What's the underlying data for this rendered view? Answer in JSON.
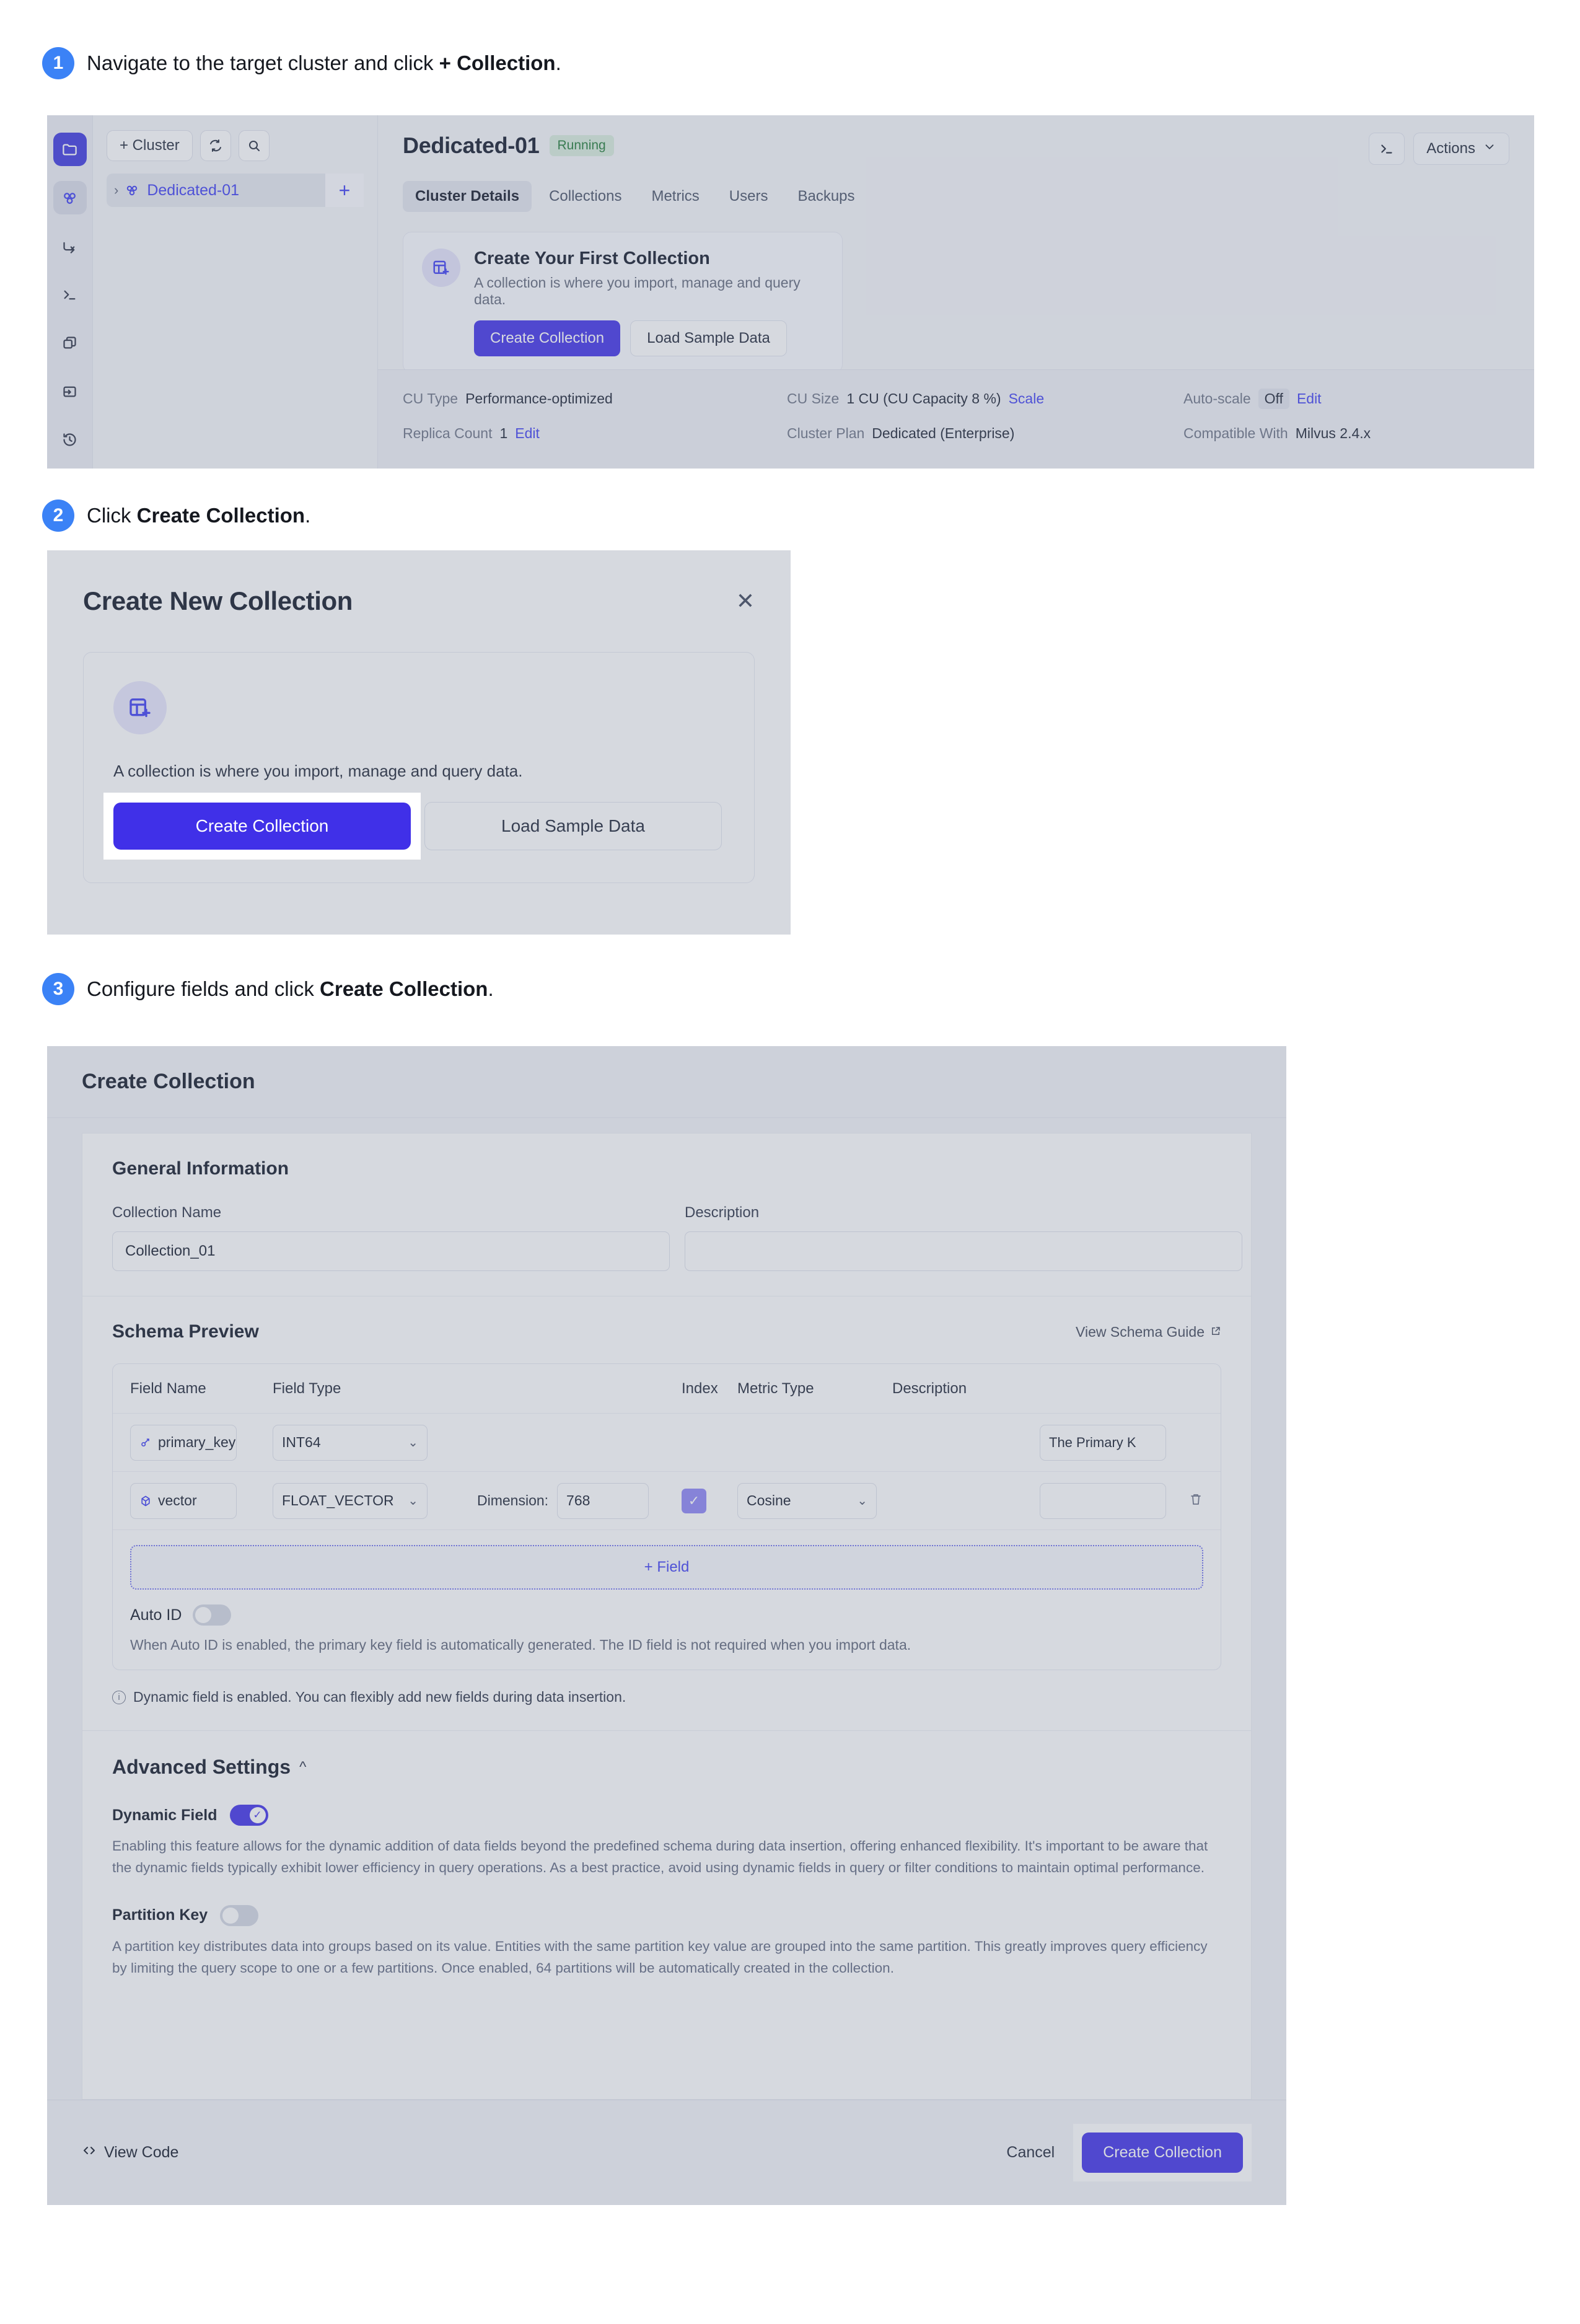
{
  "steps": [
    {
      "num": "1",
      "prefix": "Navigate to the target cluster and click ",
      "bold": "+ Collection",
      "suffix": "."
    },
    {
      "num": "2",
      "prefix": "Click ",
      "bold": "Create Collection",
      "suffix": "."
    },
    {
      "num": "3",
      "prefix": "Configure fields and click ",
      "bold": "Create Collection",
      "suffix": "."
    }
  ],
  "panel1": {
    "cluster_pane": {
      "add_cluster_label": "+ Cluster",
      "refresh_icon": "refresh-icon",
      "search_icon": "search-icon",
      "cluster_name": "Dedicated-01",
      "add_collection_label": "+"
    },
    "rail_icons": [
      "folder-icon",
      "cluster-icon",
      "import-icon",
      "console-icon",
      "copy-icon",
      "export-icon",
      "history-icon"
    ],
    "header": {
      "title": "Dedicated-01",
      "status": "Running",
      "terminal_icon": "terminal-icon",
      "actions_label": "Actions"
    },
    "tabs": [
      {
        "label": "Cluster Details",
        "selected": true
      },
      {
        "label": "Collections",
        "selected": false
      },
      {
        "label": "Metrics",
        "selected": false
      },
      {
        "label": "Users",
        "selected": false
      },
      {
        "label": "Backups",
        "selected": false
      }
    ],
    "first_collection_card": {
      "icon": "table-plus-icon",
      "title": "Create Your First Collection",
      "subtitle": "A collection is where you import, manage and query data.",
      "primary_button": "Create Collection",
      "secondary_button": "Load Sample Data"
    },
    "stats": [
      {
        "label": "CU Type",
        "value": "Performance-optimized",
        "link": "",
        "pill": ""
      },
      {
        "label": "CU Size",
        "value": "1 CU (CU Capacity 8 %)",
        "link": "Scale",
        "pill": ""
      },
      {
        "label": "Auto-scale",
        "value": "",
        "link": "Edit",
        "pill": "Off"
      },
      {
        "label": "Replica Count",
        "value": "1",
        "link": "Edit",
        "pill": ""
      },
      {
        "label": "Cluster Plan",
        "value": "Dedicated (Enterprise)",
        "link": "",
        "pill": ""
      },
      {
        "label": "Compatible With",
        "value": "Milvus 2.4.x",
        "link": "",
        "pill": ""
      }
    ]
  },
  "panel2": {
    "title": "Create New Collection",
    "close_icon": "close-icon",
    "icon": "table-plus-icon",
    "description": "A collection is where you import, manage and query data.",
    "primary_button": "Create Collection",
    "secondary_button": "Load Sample Data"
  },
  "panel3": {
    "title": "Create Collection",
    "general": {
      "heading": "General Information",
      "name_label": "Collection Name",
      "name_value": "Collection_01",
      "description_label": "Description",
      "description_value": ""
    },
    "schema": {
      "heading": "Schema Preview",
      "guide_link": "View Schema Guide",
      "columns": [
        "Field Name",
        "Field Type",
        "Index",
        "Metric Type",
        "Description"
      ],
      "rows": [
        {
          "icon": "key-icon",
          "name": "primary_key",
          "type": "INT64",
          "dimension_label": "",
          "dimension_value": "",
          "index_checked": false,
          "metric": "",
          "description": "The Primary K",
          "deletable": false
        },
        {
          "icon": "vector-icon",
          "name": "vector",
          "type": "FLOAT_VECTOR",
          "dimension_label": "Dimension:",
          "dimension_value": "768",
          "index_checked": true,
          "metric": "Cosine",
          "description": "",
          "deletable": true
        }
      ],
      "add_field_label": "+ Field",
      "auto_id_label": "Auto ID",
      "auto_id_on": false,
      "auto_id_note": "When Auto ID is enabled, the primary key field is automatically generated. The ID field is not required when you import data.",
      "dynamic_note": "Dynamic field is enabled. You can flexibly add new fields during data insertion."
    },
    "advanced": {
      "heading": "Advanced Settings",
      "collapse_icon": "chevron-up-icon",
      "options": [
        {
          "label": "Dynamic Field",
          "enabled": true,
          "description": "Enabling this feature allows for the dynamic addition of data fields beyond the predefined schema during data insertion, offering enhanced flexibility. It's important to be aware that the dynamic fields typically exhibit lower efficiency in query operations. As a best practice, avoid using dynamic fields in query or filter conditions to maintain optimal performance."
        },
        {
          "label": "Partition Key",
          "enabled": false,
          "description": "A partition key distributes data into groups based on its value. Entities with the same partition key value are grouped into the same partition. This greatly improves query efficiency by limiting the query scope to one or a few partitions. Once enabled, 64 partitions will be automatically created in the collection."
        }
      ]
    },
    "footer": {
      "view_code_label": "View Code",
      "view_code_icon": "code-icon",
      "cancel_label": "Cancel",
      "create_label": "Create Collection"
    }
  },
  "colors": {
    "accent": "#4030e8",
    "step_badge": "#3b82f6",
    "link": "#3d3df2",
    "status_green_text": "#1f7a36",
    "status_green_bg": "#d9ecdd"
  }
}
